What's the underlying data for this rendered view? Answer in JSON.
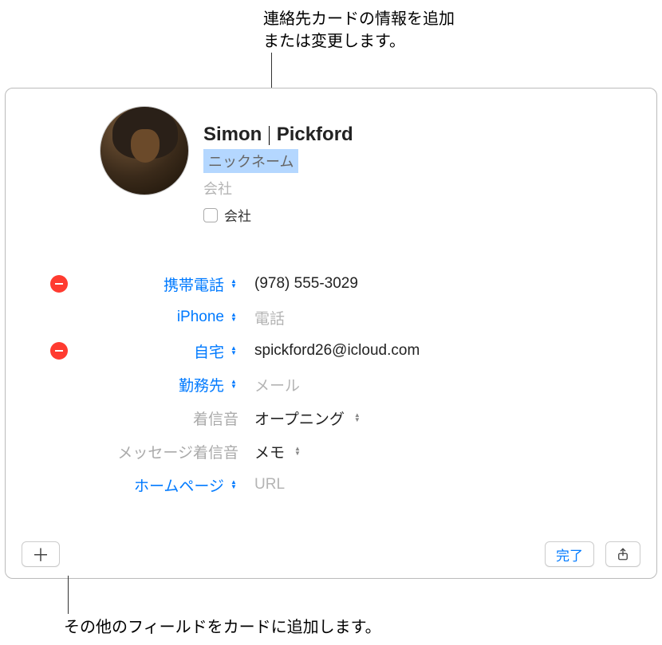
{
  "callouts": {
    "top": "連絡先カードの情報を追加\nまたは変更します。",
    "bottom": "その他のフィールドをカードに追加します。"
  },
  "header": {
    "first_name": "Simon",
    "last_name": "Pickford",
    "nickname_placeholder": "ニックネーム",
    "company_placeholder": "会社",
    "company_checkbox_label": "会社"
  },
  "fields": {
    "phone_mobile": {
      "label": "携帯電話",
      "value": "(978) 555-3029"
    },
    "phone_iphone": {
      "label": "iPhone",
      "placeholder": "電話"
    },
    "email_home": {
      "label": "自宅",
      "value": "spickford26@icloud.com"
    },
    "email_work": {
      "label": "勤務先",
      "placeholder": "メール"
    },
    "ringtone": {
      "label": "着信音",
      "value": "オープニング"
    },
    "text_tone": {
      "label": "メッセージ着信音",
      "value": "メモ"
    },
    "homepage": {
      "label": "ホームページ",
      "placeholder": "URL"
    }
  },
  "toolbar": {
    "add": "＋",
    "done": "完了"
  }
}
